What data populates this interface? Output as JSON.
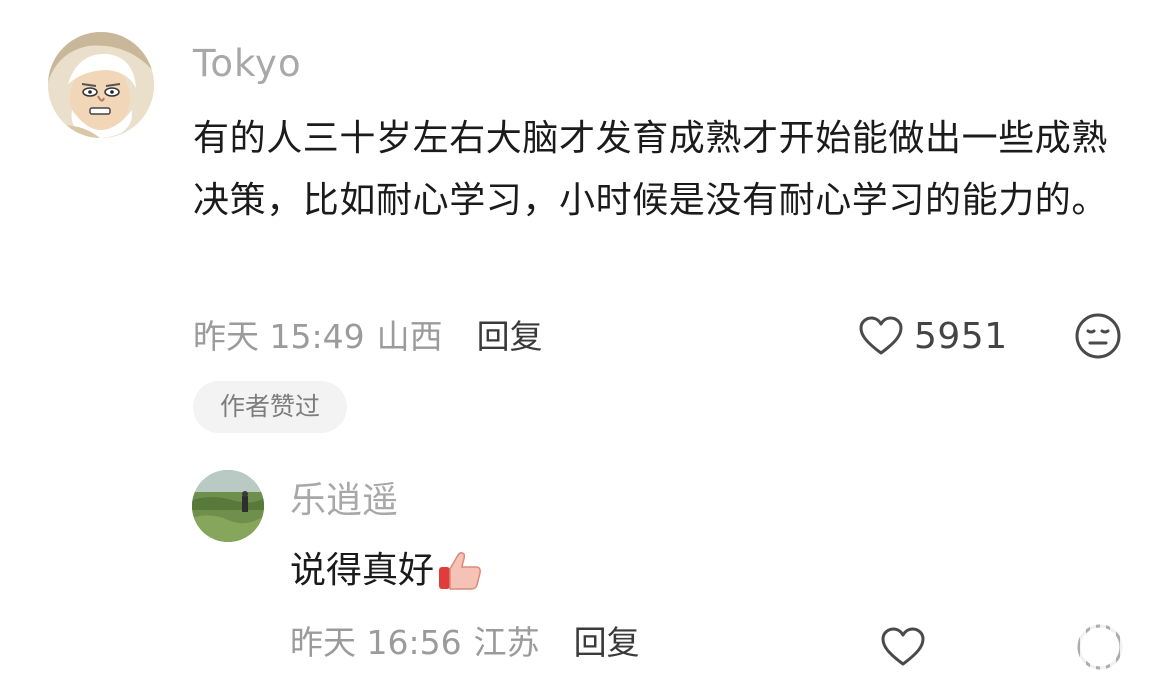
{
  "comment": {
    "username": "Tokyo",
    "content": "有的人三十岁左右大脑才发育成熟才开始能做出一些成熟决策，比如耐心学习，小时候是没有耐心学习的能力的。",
    "time": "昨天 15:49",
    "location": "山西",
    "reply_label": "回复",
    "like_count": "5951",
    "author_badge": "作者赞过",
    "icons": {
      "avatar": "cartoon-old-man-avatar",
      "like": "heart-icon",
      "dislike": "meh-face-icon"
    }
  },
  "reply": {
    "username": "乐逍遥",
    "content": "说得真好",
    "time": "昨天 16:56",
    "location": "江苏",
    "reply_label": "回复",
    "icons": {
      "avatar": "grass-field-photo-avatar",
      "emoji": "thumbs-up-icon",
      "like": "heart-icon",
      "dislike": "meh-face-icon"
    }
  },
  "colors": {
    "text_primary": "#1b1b1b",
    "text_secondary": "#9b9b9b",
    "username": "#a8a8a8",
    "badge_bg": "#f3f3f3"
  }
}
